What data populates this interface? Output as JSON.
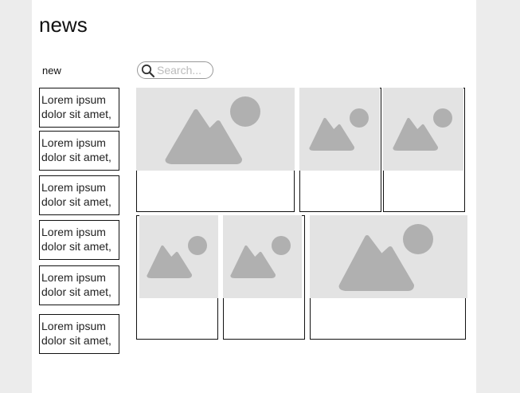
{
  "header": {
    "title": "news"
  },
  "sidebar": {
    "label": "new",
    "items": [
      {
        "text": "Lorem ipsum dolor sit amet,"
      },
      {
        "text": "Lorem ipsum dolor sit amet,"
      },
      {
        "text": "Lorem ipsum dolor sit amet,"
      },
      {
        "text": "Lorem ipsum dolor sit amet,"
      },
      {
        "text": "Lorem ipsum dolor sit amet,"
      },
      {
        "text": "Lorem ipsum dolor sit amet,"
      }
    ]
  },
  "search": {
    "placeholder": "Search...",
    "value": ""
  },
  "cards": {
    "count": 6,
    "thumbnail_icon": "image-placeholder-icon"
  },
  "colors": {
    "placeholder_bg": "#e3e3e3",
    "placeholder_shape": "#b0b0b0"
  }
}
